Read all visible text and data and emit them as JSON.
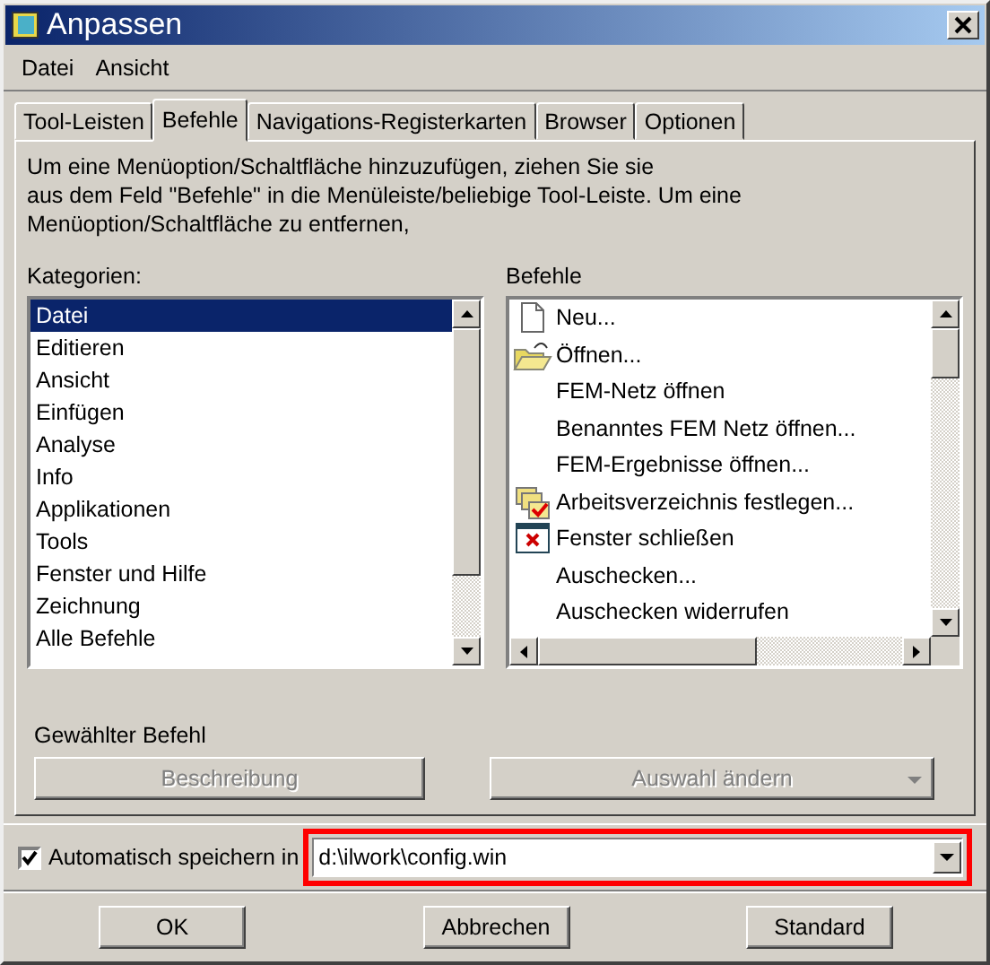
{
  "window": {
    "title": "Anpassen"
  },
  "menu": [
    "Datei",
    "Ansicht"
  ],
  "tabs": [
    {
      "label": "Tool-Leisten",
      "selected": false
    },
    {
      "label": "Befehle",
      "selected": true
    },
    {
      "label": "Navigations-Registerkarten",
      "selected": false
    },
    {
      "label": "Browser",
      "selected": false
    },
    {
      "label": "Optionen",
      "selected": false
    }
  ],
  "instructions": [
    "Um eine Menüoption/Schaltfläche hinzuzufügen, ziehen Sie sie",
    "aus dem Feld \"Befehle\" in die Menüleiste/beliebige Tool-Leiste. Um eine",
    "Menüoption/Schaltfläche zu entfernen,"
  ],
  "categories": {
    "label": "Kategorien:",
    "items": [
      {
        "label": "Datei",
        "selected": true
      },
      {
        "label": "Editieren",
        "selected": false
      },
      {
        "label": "Ansicht",
        "selected": false
      },
      {
        "label": "Einfügen",
        "selected": false
      },
      {
        "label": "Analyse",
        "selected": false
      },
      {
        "label": "Info",
        "selected": false
      },
      {
        "label": "Applikationen",
        "selected": false
      },
      {
        "label": "Tools",
        "selected": false
      },
      {
        "label": "Fenster und Hilfe",
        "selected": false
      },
      {
        "label": "Zeichnung",
        "selected": false
      },
      {
        "label": "Alle Befehle",
        "selected": false
      }
    ]
  },
  "commands": {
    "label": "Befehle",
    "items": [
      {
        "label": "Neu...",
        "kind": "page"
      },
      {
        "label": "Öffnen...",
        "kind": "folder"
      },
      {
        "label": "FEM-Netz öffnen",
        "kind": "plain"
      },
      {
        "label": "Benanntes FEM Netz öffnen...",
        "kind": "plain"
      },
      {
        "label": "FEM-Ergebnisse öffnen...",
        "kind": "plain"
      },
      {
        "label": "Arbeitsverzeichnis festlegen...",
        "kind": "folders"
      },
      {
        "label": "Fenster schließen",
        "kind": "close"
      },
      {
        "label": "Auschecken...",
        "kind": "plain"
      },
      {
        "label": "Auschecken widerrufen",
        "kind": "plain"
      }
    ]
  },
  "selected_command": {
    "label": "Gewählter Befehl",
    "description_button": {
      "label": "Beschreibung",
      "disabled": true
    },
    "modify_button": {
      "label": "Auswahl ändern",
      "disabled": true
    }
  },
  "autosave": {
    "label": "Automatisch speichern in",
    "checked": true,
    "value": "d:\\ilwork\\config.win"
  },
  "buttons": [
    "OK",
    "Abbrechen",
    "Standard"
  ]
}
